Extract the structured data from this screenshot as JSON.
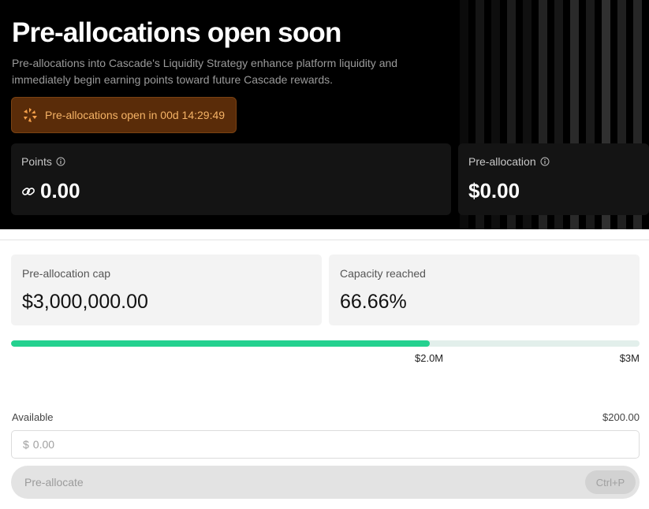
{
  "hero": {
    "title": "Pre-allocations open soon",
    "description": "Pre-allocations into Cascade's Liquidity Strategy enhance platform liquidity and immediately begin earning points toward future Cascade rewards.",
    "countdown": {
      "text": "Pre-allocations open in 00d 14:29:49",
      "icon": "cascade-logo-icon"
    }
  },
  "stats": {
    "points": {
      "label": "Points",
      "value": "0.00",
      "icon": "points-link-icon"
    },
    "preallocation": {
      "label": "Pre-allocation",
      "value": "$0.00"
    }
  },
  "cards": {
    "cap": {
      "label": "Pre-allocation cap",
      "value": "$3,000,000.00"
    },
    "capacity": {
      "label": "Capacity reached",
      "value": "66.66%"
    }
  },
  "progress": {
    "fraction": 0.6666,
    "marker_label": "$2.0M",
    "end_label": "$3M"
  },
  "form": {
    "available_label": "Available",
    "available_value": "$200.00",
    "currency_symbol": "$",
    "amount_placeholder": "0.00",
    "submit_label": "Pre-allocate",
    "shortcut": "Ctrl+P"
  },
  "colors": {
    "accent": "#24d18f",
    "countdown_bg": "#5a2c09",
    "countdown_text": "#f5b366"
  }
}
